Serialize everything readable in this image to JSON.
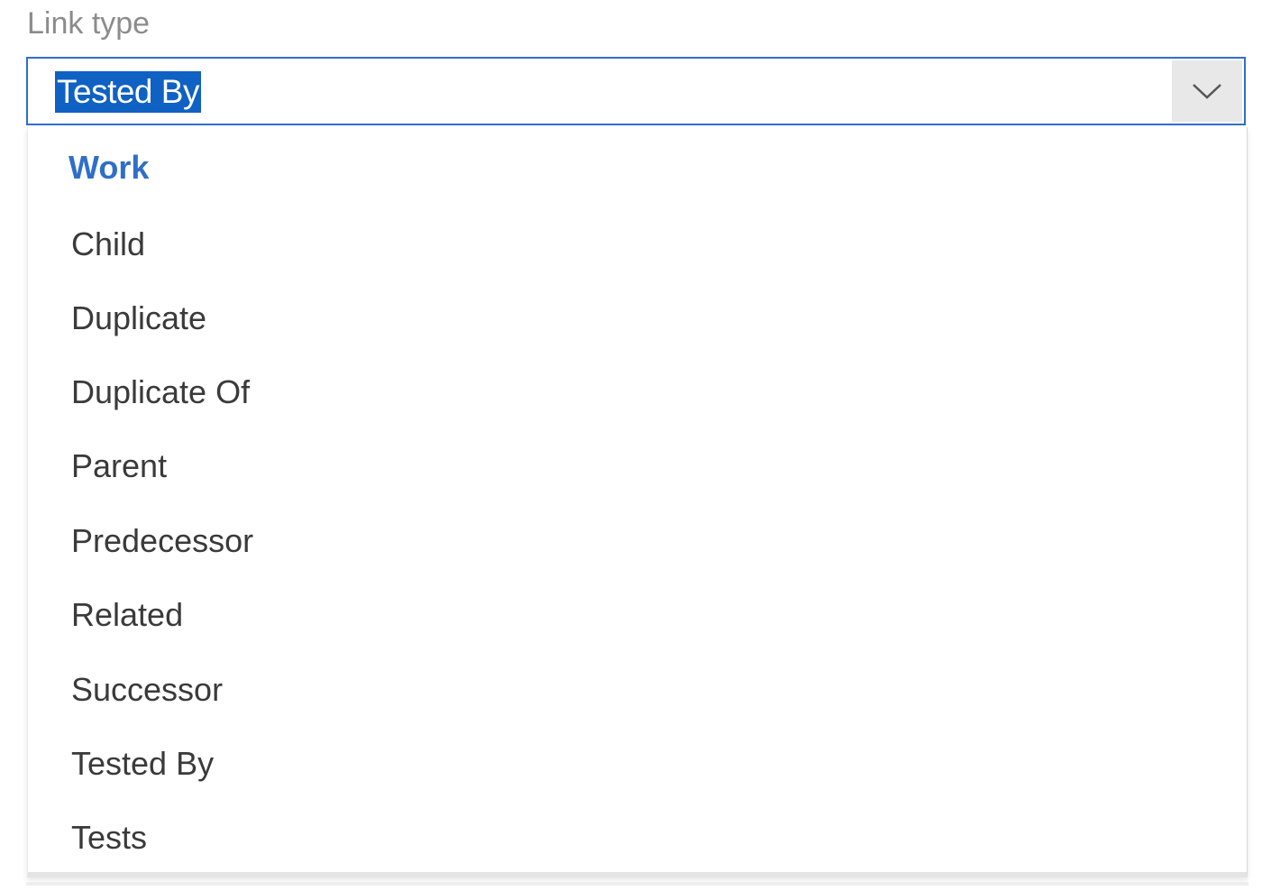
{
  "field": {
    "label": "Link type",
    "selected_value": "Tested By",
    "accent_color": "#2f6fc9"
  },
  "dropdown": {
    "group_header": "Work",
    "options": [
      "Child",
      "Duplicate",
      "Duplicate Of",
      "Parent",
      "Predecessor",
      "Related",
      "Successor",
      "Tested By",
      "Tests"
    ]
  },
  "icons": {
    "toggle": "chevron-down-icon"
  }
}
